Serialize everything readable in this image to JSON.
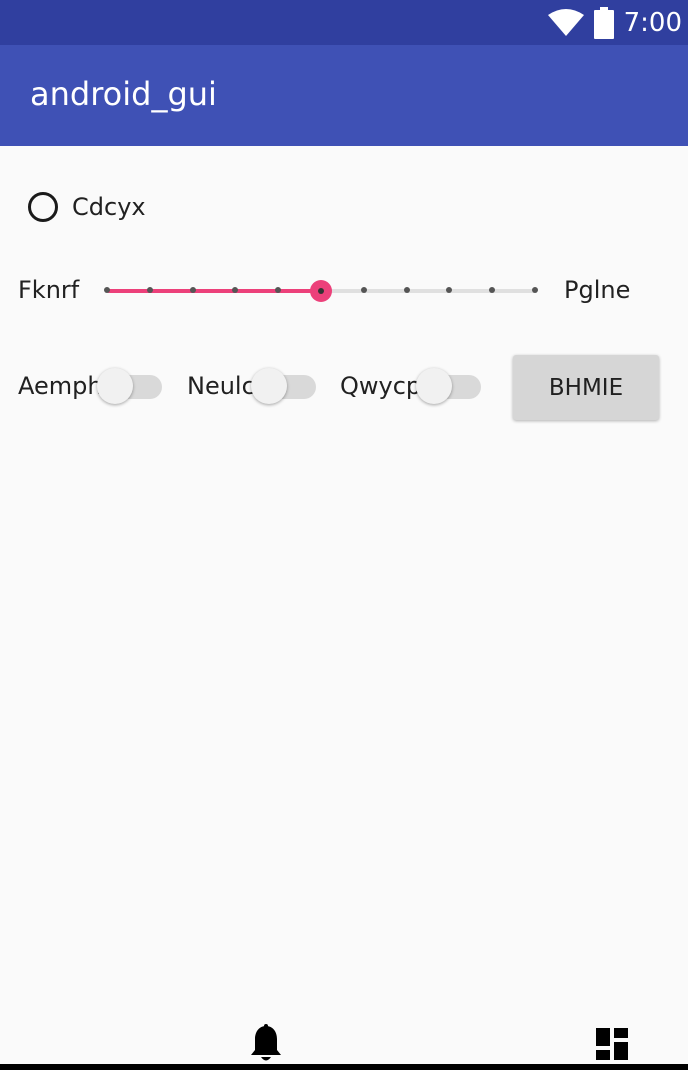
{
  "status_bar": {
    "time": "7:00",
    "icons": [
      "wifi-icon",
      "battery-icon"
    ]
  },
  "app_bar": {
    "title": "android_gui"
  },
  "radio": {
    "label": "Cdcyx",
    "checked": false
  },
  "slider": {
    "left_label": "Fknrf",
    "right_label": "Pglne",
    "steps": 10,
    "value": 5,
    "accent_color": "#ec407a"
  },
  "switches": [
    {
      "label": "Aemph",
      "on": false
    },
    {
      "label": "Neulc",
      "on": false
    },
    {
      "label": "Qwycp",
      "on": false
    }
  ],
  "button": {
    "label": "BHMIE"
  },
  "bottom_nav": {
    "icons": [
      "bell-icon",
      "dashboard-icon"
    ]
  },
  "colors": {
    "status_bar": "#303f9f",
    "app_bar": "#3f51b5",
    "background": "#fafafa"
  }
}
